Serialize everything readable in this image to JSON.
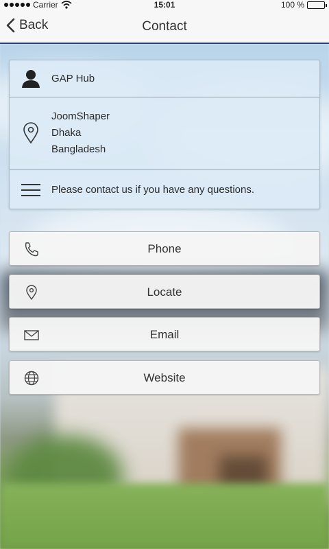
{
  "status_bar": {
    "carrier": "Carrier",
    "time": "15:01",
    "battery": "100 %",
    "battery_level": 1.0,
    "signal_icon": "signal-dots-icon",
    "wifi_icon": "wifi-icon"
  },
  "nav": {
    "back_label": "Back",
    "title": "Contact",
    "accent_color": "#2c3e78"
  },
  "info": {
    "name": "GAP Hub",
    "name_icon": "person-icon",
    "address_lines": [
      "JoomShaper",
      "Dhaka",
      "Bangladesh"
    ],
    "address_icon": "map-pin-icon",
    "note": "Please contact us if you have any questions.",
    "note_icon": "menu-lines-icon"
  },
  "actions": [
    {
      "label": "Phone",
      "icon": "phone-icon"
    },
    {
      "label": "Locate",
      "icon": "map-pin-icon"
    },
    {
      "label": "Email",
      "icon": "envelope-icon"
    },
    {
      "label": "Website",
      "icon": "globe-icon"
    }
  ]
}
